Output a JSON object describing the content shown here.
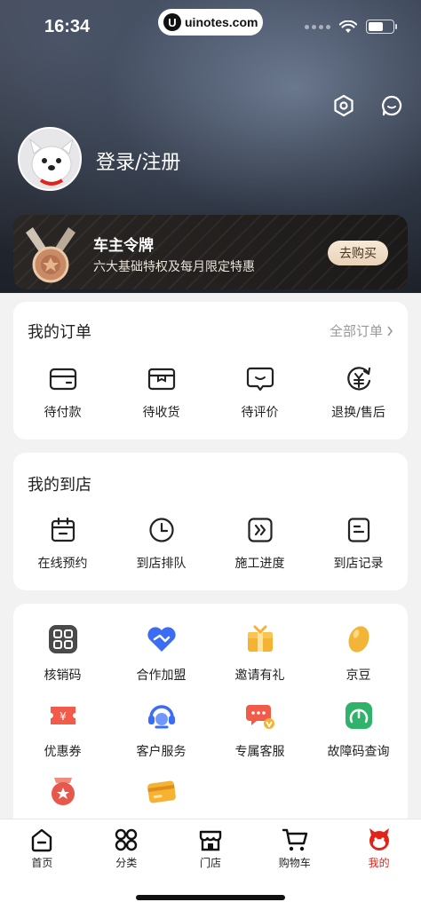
{
  "status_bar": {
    "time": "16:34",
    "url": "uinotes.com",
    "url_logo": "U"
  },
  "header": {
    "settings_icon": "hexagon-settings-icon",
    "message_icon": "message-bubble-icon",
    "login_label": "登录/注册"
  },
  "vip": {
    "title": "车主令牌",
    "subtitle": "六大基础特权及每月限定特惠",
    "button": "去购买"
  },
  "orders": {
    "title": "我的订单",
    "more": "全部订单",
    "items": [
      {
        "label": "待付款",
        "icon": "wallet-icon"
      },
      {
        "label": "待收货",
        "icon": "package-icon"
      },
      {
        "label": "待评价",
        "icon": "comment-icon"
      },
      {
        "label": "退换/售后",
        "icon": "refund-icon"
      }
    ]
  },
  "store": {
    "title": "我的到店",
    "items": [
      {
        "label": "在线预约",
        "icon": "calendar-icon"
      },
      {
        "label": "到店排队",
        "icon": "clock-icon"
      },
      {
        "label": "施工进度",
        "icon": "progress-icon"
      },
      {
        "label": "到店记录",
        "icon": "record-icon"
      }
    ]
  },
  "services": {
    "row1": [
      {
        "label": "核销码",
        "icon": "qrcode-icon"
      },
      {
        "label": "合作加盟",
        "icon": "handshake-icon"
      },
      {
        "label": "邀请有礼",
        "icon": "gift-icon"
      },
      {
        "label": "京豆",
        "icon": "bean-icon"
      }
    ],
    "row2": [
      {
        "label": "优惠券",
        "icon": "coupon-icon"
      },
      {
        "label": "客户服务",
        "icon": "headset-icon"
      },
      {
        "label": "专属客服",
        "icon": "vip-chat-icon"
      },
      {
        "label": "故障码查询",
        "icon": "gauge-icon"
      }
    ],
    "row3": [
      {
        "label": "",
        "icon": "medal-badge-icon"
      },
      {
        "label": "",
        "icon": "card-icon"
      }
    ]
  },
  "tabbar": {
    "items": [
      {
        "label": "首页",
        "icon": "home-icon"
      },
      {
        "label": "分类",
        "icon": "category-icon"
      },
      {
        "label": "门店",
        "icon": "store-icon"
      },
      {
        "label": "购物车",
        "icon": "cart-icon"
      },
      {
        "label": "我的",
        "icon": "mascot-icon"
      }
    ],
    "active_index": 4
  },
  "colors": {
    "accent": "#e2231a",
    "vip_gold": "#e9d3b8"
  }
}
